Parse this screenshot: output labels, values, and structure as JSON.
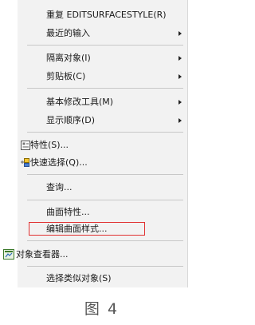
{
  "menu": {
    "items": [
      {
        "label": "重复 EDITSURFACESTYLE(R)"
      },
      {
        "label": "最近的输入"
      },
      {
        "label": "隔离对象(I)"
      },
      {
        "label": "剪贴板(C)"
      },
      {
        "label": "基本修改工具(M)"
      },
      {
        "label": "显示顺序(D)"
      },
      {
        "label": "特性(S)..."
      },
      {
        "label": "快速选择(Q)..."
      },
      {
        "label": "查询..."
      },
      {
        "label": "曲面特性..."
      },
      {
        "label": "编辑曲面样式..."
      },
      {
        "label": "对象查看器..."
      },
      {
        "label": "选择类似对象(S)"
      }
    ]
  },
  "caption": "图 4",
  "colors": {
    "menu_bg": "#f2f2f2",
    "highlight_border": "#e03030",
    "separator": "#c8c8c8"
  },
  "icons": [
    "submenu-arrow-icon",
    "properties-icon",
    "quick-select-icon",
    "object-viewer-icon"
  ]
}
